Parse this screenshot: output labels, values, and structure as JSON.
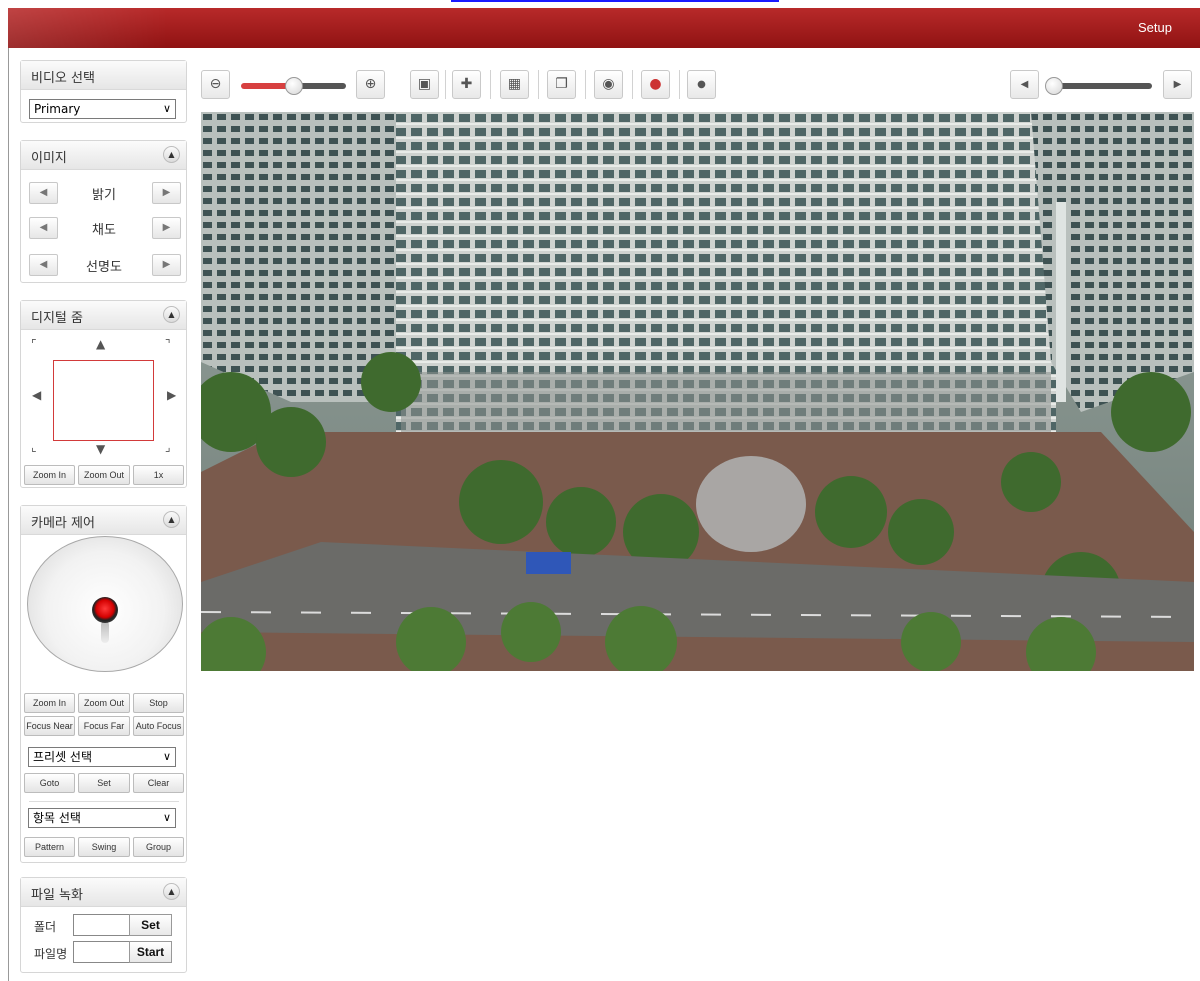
{
  "header": {
    "setup_label": "Setup"
  },
  "video_select": {
    "title": "비디오 선택",
    "selected": "Primary"
  },
  "image_panel": {
    "title": "이미지",
    "rows": [
      {
        "label": "밝기"
      },
      {
        "label": "채도"
      },
      {
        "label": "선명도"
      }
    ]
  },
  "digital_zoom": {
    "title": "디지털 줌",
    "buttons": {
      "zoom_in": "Zoom In",
      "zoom_out": "Zoom Out",
      "reset": "1x"
    }
  },
  "camera_control": {
    "title": "카메라 제어",
    "buttons": {
      "zoom_in": "Zoom In",
      "zoom_out": "Zoom Out",
      "stop": "Stop",
      "focus_near": "Focus Near",
      "focus_far": "Focus Far",
      "auto_focus": "Auto Focus",
      "goto": "Goto",
      "set": "Set",
      "clear": "Clear",
      "pattern": "Pattern",
      "swing": "Swing",
      "group": "Group"
    },
    "preset_select": "프리셋 선택",
    "item_select": "항목 선택"
  },
  "file_record": {
    "title": "파일 녹화",
    "folder_label": "폴더",
    "filename_label": "파일명",
    "folder_value": "",
    "filename_value": "",
    "set_button": "Set",
    "start_button": "Start"
  },
  "toolbar": {
    "icons": [
      "zoom-out-icon",
      "zoom-in-icon",
      "fullscreen-icon",
      "motion-icon",
      "capture-icon",
      "copy-icon",
      "snapshot-icon",
      "audio-icon",
      "record-icon"
    ],
    "zoom_slider_level": 0.5,
    "volume_slider_level": 0.05
  },
  "colors": {
    "header": "#a31c1c",
    "accent": "#d23a3a"
  }
}
